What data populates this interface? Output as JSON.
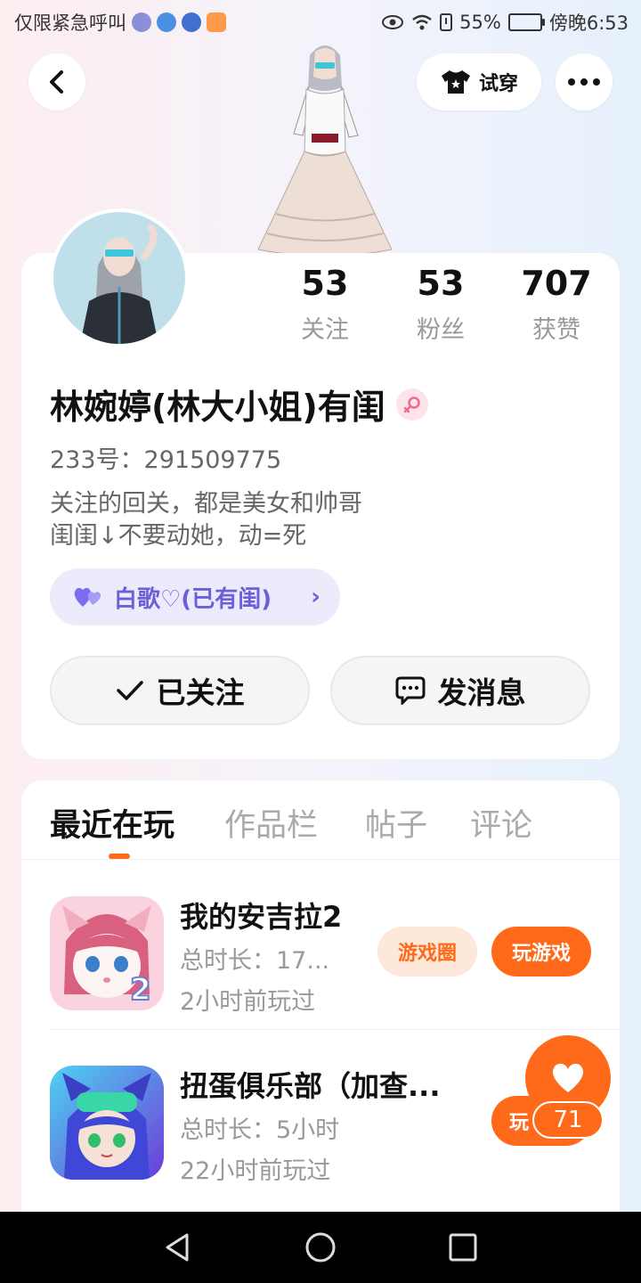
{
  "status_bar": {
    "carrier_text": "仅限紧急呼叫",
    "battery": "55%",
    "time": "傍晚6:53"
  },
  "header": {
    "try_on_label": "试穿"
  },
  "profile": {
    "following_count": "53",
    "following_label": "关注",
    "fans_count": "53",
    "fans_label": "粉丝",
    "likes_count": "707",
    "likes_label": "获赞",
    "nickname": "林婉婷(林大小姐)有闺",
    "uid": "233号：291509775",
    "bio_line1": "关注的回关，都是美女和帅哥",
    "bio_line2": "闺闺↓不要动她，动=死",
    "relation_chip": "白歌♡(已有闺)",
    "followed_label": "已关注",
    "message_label": "发消息"
  },
  "tabs": [
    {
      "label": "最近在玩"
    },
    {
      "label": "作品栏"
    },
    {
      "label": "帖子"
    },
    {
      "label": "评论"
    }
  ],
  "games": [
    {
      "title": "我的安吉拉2",
      "duration": "总时长：17...",
      "last_played": "2小时前玩过",
      "circle_label": "游戏圈",
      "play_label": "玩游戏"
    },
    {
      "title": "扭蛋俱乐部（加查...",
      "duration": "总时长：5小时",
      "last_played": "22小时前玩过",
      "play_label": "玩"
    }
  ],
  "like_fab": {
    "count": "71"
  },
  "colors": {
    "accent": "#ff6a1a",
    "chip_text": "#6e5fd9",
    "chip_bg": "#ecebfc"
  },
  "icons": {
    "back": "back-arrow-icon",
    "tshirt": "tshirt-icon",
    "more": "more-icon",
    "female": "female-icon",
    "heart": "heart-icon",
    "check": "check-icon",
    "message": "message-icon"
  }
}
